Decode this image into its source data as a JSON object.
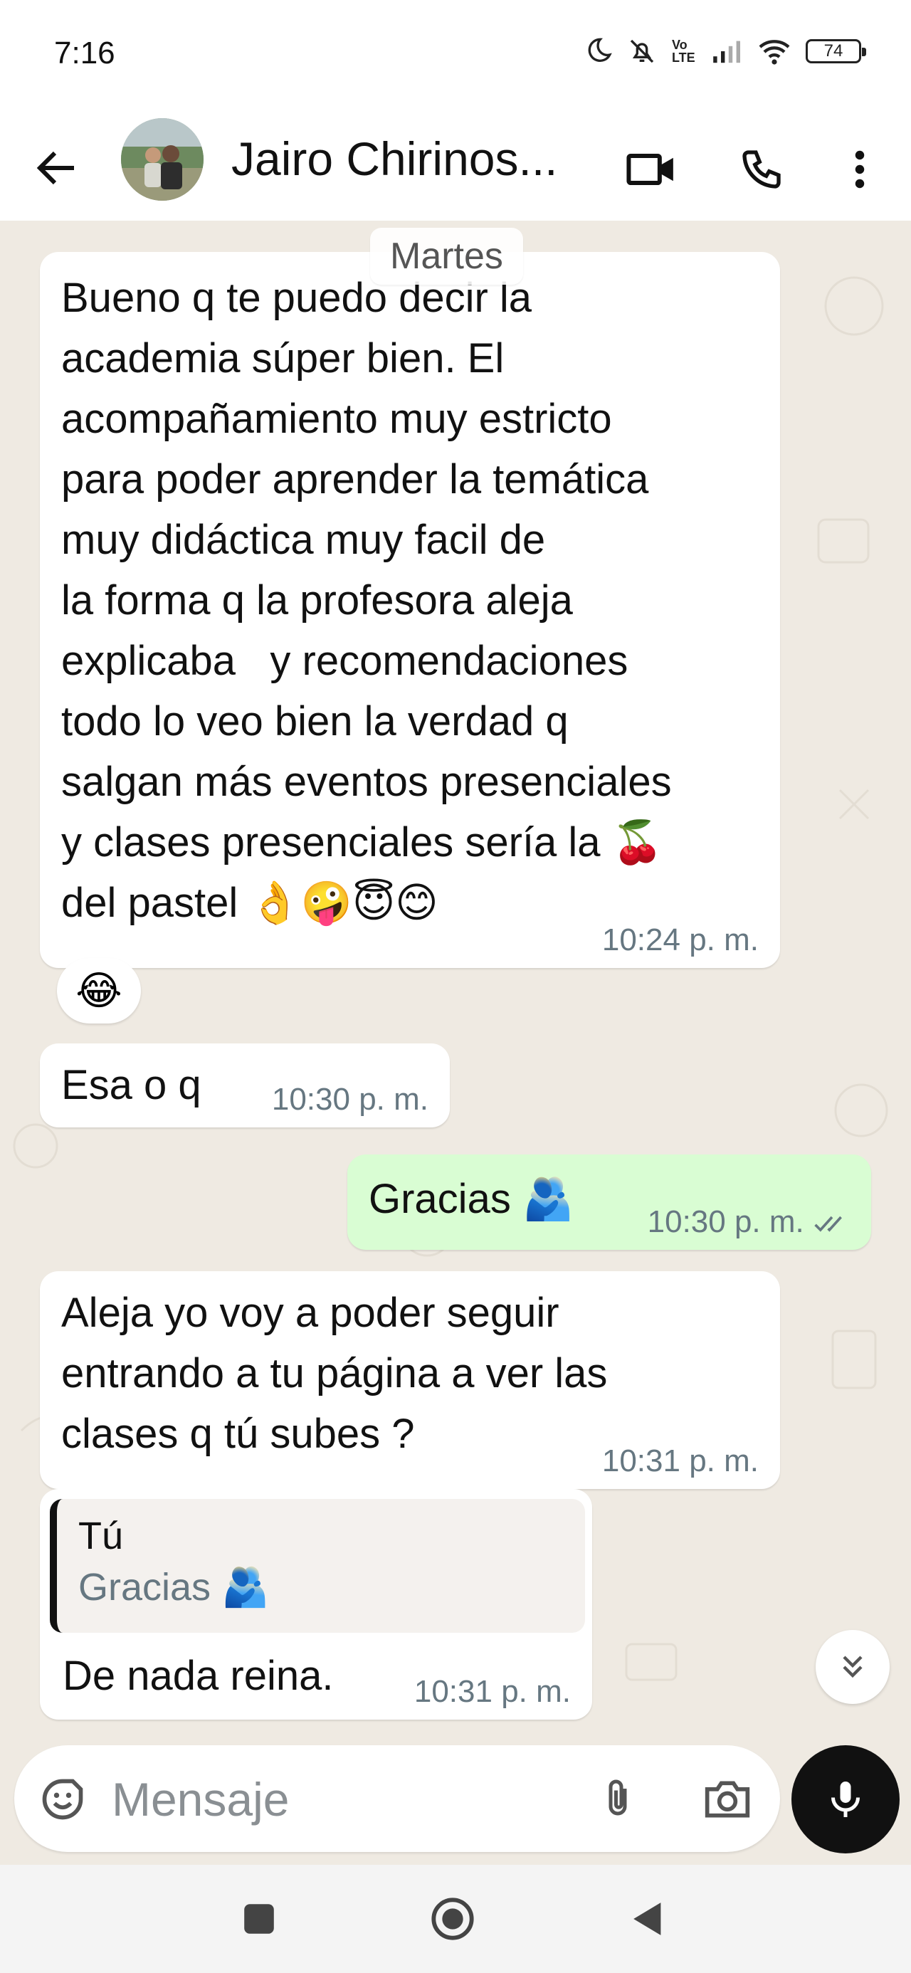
{
  "status_bar": {
    "time": "7:16",
    "network_label": "Vo LTE",
    "battery": "74"
  },
  "header": {
    "contact_name": "Jairo Chirinos...",
    "icons": [
      "back-arrow-icon",
      "video-call-icon",
      "phone-icon",
      "more-options-icon"
    ]
  },
  "chat": {
    "date_chip": "Martes",
    "messages": [
      {
        "direction": "in",
        "text": "Bueno q te puedo decir la\nacademia súper bien. El\nacompañamiento muy estricto\npara poder aprender la temática\nmuy didáctica muy facil de\nla forma q la profesora aleja\nexplicaba   y recomendaciones\ntodo lo veo bien la verdad q\nsalgan más eventos presenciales\ny clases presenciales sería la 🍒\ndel pastel 👌🤪😇😊",
        "time": "10:24 p. m.",
        "reaction": "😂"
      },
      {
        "direction": "in",
        "text": "Esa o q",
        "time": "10:30 p. m."
      },
      {
        "direction": "out",
        "text": "Gracias 🫂",
        "time": "10:30 p. m.",
        "status": "read-double-check"
      },
      {
        "direction": "in",
        "text": "Aleja yo voy a poder seguir\nentrando a tu página a ver las\nclases q tú subes ?",
        "time": "10:31 p. m."
      },
      {
        "direction": "in",
        "quote": {
          "author": "Tú",
          "text": "Gracias 🫂"
        },
        "text": "De nada reina.",
        "time": "10:31 p. m."
      }
    ]
  },
  "composer": {
    "placeholder": "Mensaje",
    "icons": [
      "emoji-sticker-icon",
      "attach-clip-icon",
      "camera-icon",
      "microphone-icon"
    ]
  },
  "nav_bar": {
    "icons": [
      "recents-square-icon",
      "home-circle-icon",
      "back-triangle-icon"
    ]
  },
  "colors": {
    "chat_background": "#efeae2",
    "incoming_bubble": "#ffffff",
    "outgoing_bubble": "#d9fdd3",
    "timestamp": "#667781",
    "read_check": "#667781",
    "mic_button": "#111111"
  }
}
